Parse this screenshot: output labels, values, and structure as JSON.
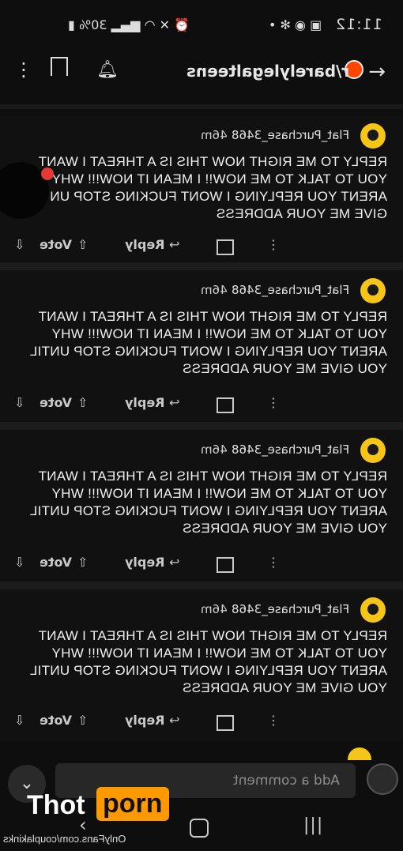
{
  "status_bar": {
    "time": "11:12",
    "battery": "30%",
    "icons": [
      "battery-icon",
      "signal-icon",
      "lte-icon",
      "wifi-icon",
      "mute-icon",
      "alarm-icon",
      "dot-icon",
      "settings-icon",
      "messenger-icon",
      "gallery-icon"
    ]
  },
  "header": {
    "subreddit": "r/barelylegalteens",
    "back_icon": "arrow-left-icon",
    "actions": [
      "notification-bell-icon",
      "bookmark-icon",
      "more-vertical-icon"
    ]
  },
  "comments": [
    {
      "author": "Flat_Purchase_3468",
      "age": "46m",
      "text": "REPLY TO ME RIGHT NOW THIS IS A THREAT I WANT YOU TO TALK TO ME NOW!! I MEAN IT NOW!!! WHY ARENT YOU REPLYING I WONT FUCKING STOP UN YOU GIVE ME YOUR ADDRESS",
      "reply_label": "Reply",
      "vote_label": "Vote"
    },
    {
      "author": "Flat_Purchase_3468",
      "age": "46m",
      "text": "REPLY TO ME RIGHT NOW THIS IS A THREAT I WANT YOU TO TALK TO ME NOW!! I MEAN IT NOW!!! WHY ARENT YOU REPLYING I WONT FUCKING STOP UNTIL YOU GIVE ME YOUR ADDRESS",
      "reply_label": "Reply",
      "vote_label": "Vote"
    },
    {
      "author": "Flat_Purchase_3468",
      "age": "46m",
      "text": "REPLY TO ME RIGHT NOW THIS IS A THREAT I WANT YOU TO TALK TO ME NOW!! I MEAN IT NOW!!! WHY ARENT YOU REPLYING I WONT FUCKING STOP UNTIL YOU GIVE ME YOUR ADDRESS",
      "reply_label": "Reply",
      "vote_label": "Vote"
    },
    {
      "author": "Flat_Purchase_3468",
      "age": "46m",
      "text": "REPLY TO ME RIGHT NOW THIS IS A THREAT I WANT YOU TO TALK TO ME NOW!! I MEAN IT NOW!!! WHY ARENT YOU REPLYING I WONT FUCKING STOP UNTIL YOU GIVE ME YOUR ADDRESS",
      "reply_label": "Reply",
      "vote_label": "Vote"
    }
  ],
  "comment_bar": {
    "placeholder": "Add a comment"
  },
  "watermark": {
    "thot": "Thot",
    "porn": "porn",
    "onlyfans": "OnlyFans.com/couplakinks"
  },
  "colors": {
    "background": "#0e0e0e",
    "card": "#111111",
    "avatar": "#f5c518",
    "watermark_accent": "#ff9900"
  }
}
